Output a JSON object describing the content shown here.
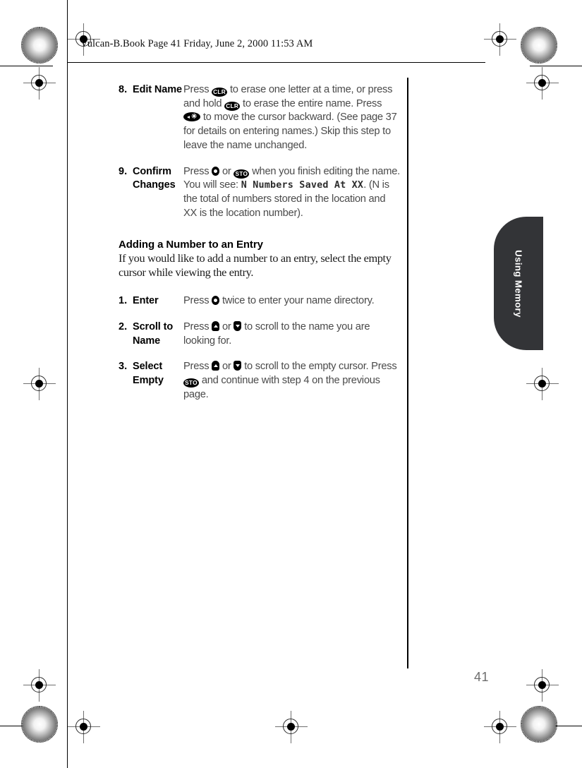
{
  "header": {
    "filename_line": "Vulcan-B.Book  Page 41  Friday, June 2, 2000  11:53 AM"
  },
  "keys": {
    "clr": "CLR",
    "sto": "STO",
    "back_star": "◄✳",
    "select": "select-dot",
    "up": "up",
    "down": "down"
  },
  "steps_continued": [
    {
      "number": "8.",
      "label": "Edit Name",
      "body_parts": [
        {
          "type": "text",
          "value": "Press "
        },
        {
          "type": "key",
          "value": "CLR"
        },
        {
          "type": "text",
          "value": " to erase one letter at a time, or press and hold "
        },
        {
          "type": "key",
          "value": "CLR"
        },
        {
          "type": "text",
          "value": " to erase the entire name. Press "
        },
        {
          "type": "key",
          "value": "◄✳"
        },
        {
          "type": "text",
          "value": " to move the cursor backward. (See page 37 for details on entering names.) Skip this step to leave the name unchanged."
        }
      ],
      "body_plain": "Press CLR to erase one letter at a time, or press and hold CLR to erase the entire name. Press ◄✳ to move the cursor backward. (See page 37 for details on entering names.) Skip this step to leave the name unchanged."
    },
    {
      "number": "9.",
      "label": "Confirm Changes",
      "body_plain": "Press ◆ or STO when you finish editing the name. You will see: N Numbers Saved At XX. (N is the total of numbers stored in the location and XX is the location number).",
      "display_text": "N Numbers Saved At XX"
    }
  ],
  "section": {
    "heading": "Adding a Number to an Entry",
    "paragraph": "If you would like to add a number to an entry, select the empty cursor while viewing the entry."
  },
  "steps": [
    {
      "number": "1.",
      "label": "Enter",
      "body_plain": "Press ◆ twice to enter your name directory."
    },
    {
      "number": "2.",
      "label": "Scroll to Name",
      "body_plain": "Press ▲ or ▼ to scroll to the name you are looking for."
    },
    {
      "number": "3.",
      "label": "Select Empty",
      "body_plain": "Press ▲ or ▼ to scroll to the empty cursor. Press STO and continue with step 4 on the previous page."
    }
  ],
  "side_tab": {
    "label": "Using Memory",
    "color": "#333437"
  },
  "footer": {
    "page_number": "41"
  },
  "fragments": {
    "s8_a": "Press ",
    "s8_b": " to erase one letter at a time, or press and hold ",
    "s8_c": " to erase the entire name. Press ",
    "s8_d": " to move the cursor backward. (See page 37 for details on entering names.) Skip this step to leave the name unchanged.",
    "s9_a": "Press ",
    "s9_b": " or ",
    "s9_c": " when you finish editing the name. You will see: ",
    "s9_lcd1": "N Numbers Saved At XX",
    "s9_d": ". (N is the total of numbers stored in the location and XX is the location number).",
    "s1_a": "Press ",
    "s1_b": " twice to enter your name directory.",
    "s2_a": "Press ",
    "s2_b": " or ",
    "s2_c": " to scroll to the name you are looking for.",
    "s3_a": "Press ",
    "s3_b": " or ",
    "s3_c": " to scroll to the empty cursor. Press ",
    "s3_d": " and continue with step 4 on the previous page."
  }
}
